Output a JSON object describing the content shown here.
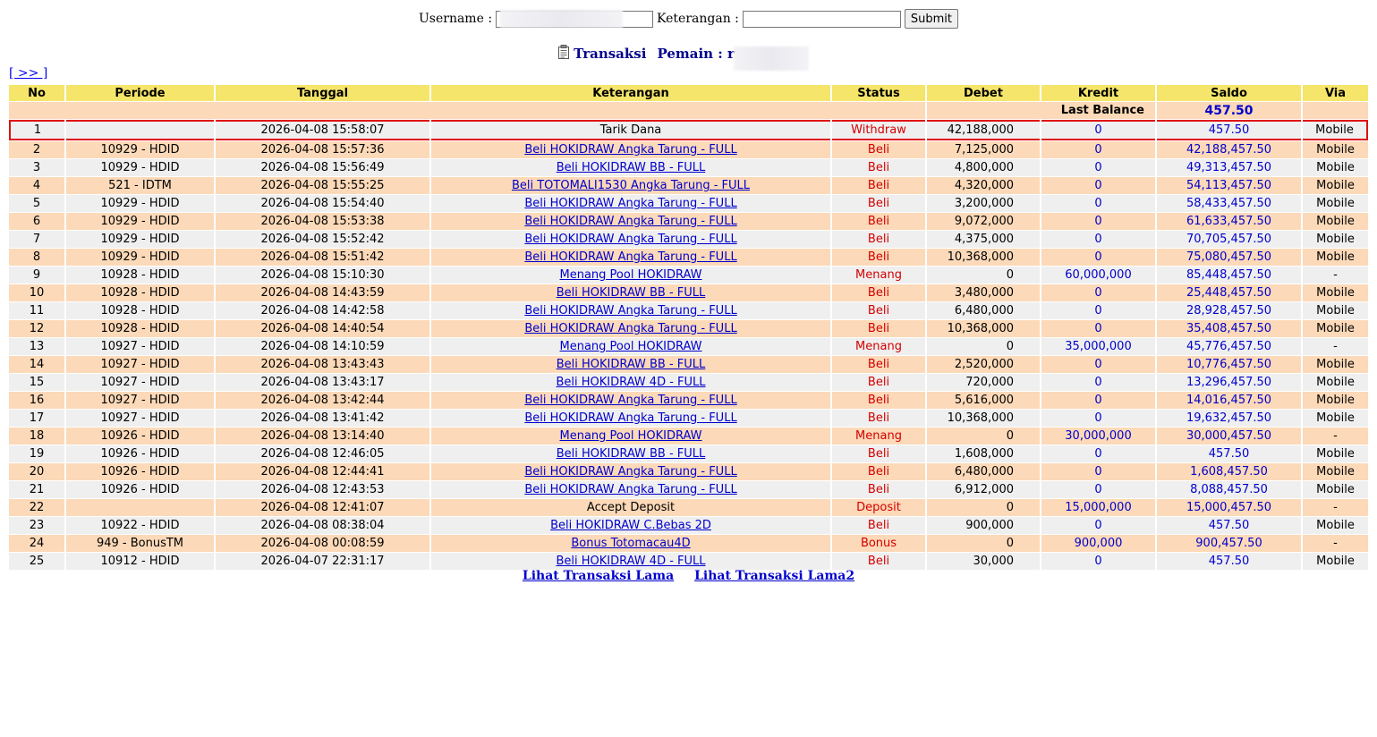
{
  "filter": {
    "username_label": "Username :",
    "username_value": "",
    "keterangan_label": "Keterangan :",
    "keterangan_value": "",
    "submit_label": "Submit"
  },
  "heading": {
    "title": "Transaksi",
    "player_label": "Pemain : ru"
  },
  "nav": {
    "next_label": "[ >> ]"
  },
  "table": {
    "columns": [
      "No",
      "Periode",
      "Tanggal",
      "Keterangan",
      "Status",
      "Debet",
      "Kredit",
      "Saldo",
      "Via"
    ],
    "last_balance_label": "Last Balance",
    "last_balance_value": "457.50",
    "rows": [
      {
        "no": "1",
        "periode": "",
        "tanggal": "2026-04-08 15:58:07",
        "keterangan": "Tarik Dana",
        "link": false,
        "status": "Withdraw",
        "debet": "42,188,000",
        "kredit": "0",
        "saldo": "457.50",
        "via": "Mobile"
      },
      {
        "no": "2",
        "periode": "10929 - HDID",
        "tanggal": "2026-04-08 15:57:36",
        "keterangan": "Beli HOKIDRAW Angka Tarung - FULL",
        "link": true,
        "status": "Beli",
        "debet": "7,125,000",
        "kredit": "0",
        "saldo": "42,188,457.50",
        "via": "Mobile"
      },
      {
        "no": "3",
        "periode": "10929 - HDID",
        "tanggal": "2026-04-08 15:56:49",
        "keterangan": "Beli HOKIDRAW BB - FULL",
        "link": true,
        "status": "Beli",
        "debet": "4,800,000",
        "kredit": "0",
        "saldo": "49,313,457.50",
        "via": "Mobile"
      },
      {
        "no": "4",
        "periode": "521 - IDTM",
        "tanggal": "2026-04-08 15:55:25",
        "keterangan": "Beli TOTOMALI1530 Angka Tarung - FULL",
        "link": true,
        "status": "Beli",
        "debet": "4,320,000",
        "kredit": "0",
        "saldo": "54,113,457.50",
        "via": "Mobile"
      },
      {
        "no": "5",
        "periode": "10929 - HDID",
        "tanggal": "2026-04-08 15:54:40",
        "keterangan": "Beli HOKIDRAW Angka Tarung - FULL",
        "link": true,
        "status": "Beli",
        "debet": "3,200,000",
        "kredit": "0",
        "saldo": "58,433,457.50",
        "via": "Mobile"
      },
      {
        "no": "6",
        "periode": "10929 - HDID",
        "tanggal": "2026-04-08 15:53:38",
        "keterangan": "Beli HOKIDRAW Angka Tarung - FULL",
        "link": true,
        "status": "Beli",
        "debet": "9,072,000",
        "kredit": "0",
        "saldo": "61,633,457.50",
        "via": "Mobile"
      },
      {
        "no": "7",
        "periode": "10929 - HDID",
        "tanggal": "2026-04-08 15:52:42",
        "keterangan": "Beli HOKIDRAW Angka Tarung - FULL",
        "link": true,
        "status": "Beli",
        "debet": "4,375,000",
        "kredit": "0",
        "saldo": "70,705,457.50",
        "via": "Mobile"
      },
      {
        "no": "8",
        "periode": "10929 - HDID",
        "tanggal": "2026-04-08 15:51:42",
        "keterangan": "Beli HOKIDRAW Angka Tarung - FULL",
        "link": true,
        "status": "Beli",
        "debet": "10,368,000",
        "kredit": "0",
        "saldo": "75,080,457.50",
        "via": "Mobile"
      },
      {
        "no": "9",
        "periode": "10928 - HDID",
        "tanggal": "2026-04-08 15:10:30",
        "keterangan": "Menang Pool HOKIDRAW",
        "link": true,
        "status": "Menang",
        "debet": "0",
        "kredit": "60,000,000",
        "saldo": "85,448,457.50",
        "via": "-"
      },
      {
        "no": "10",
        "periode": "10928 - HDID",
        "tanggal": "2026-04-08 14:43:59",
        "keterangan": "Beli HOKIDRAW BB - FULL",
        "link": true,
        "status": "Beli",
        "debet": "3,480,000",
        "kredit": "0",
        "saldo": "25,448,457.50",
        "via": "Mobile"
      },
      {
        "no": "11",
        "periode": "10928 - HDID",
        "tanggal": "2026-04-08 14:42:58",
        "keterangan": "Beli HOKIDRAW Angka Tarung - FULL",
        "link": true,
        "status": "Beli",
        "debet": "6,480,000",
        "kredit": "0",
        "saldo": "28,928,457.50",
        "via": "Mobile"
      },
      {
        "no": "12",
        "periode": "10928 - HDID",
        "tanggal": "2026-04-08 14:40:54",
        "keterangan": "Beli HOKIDRAW Angka Tarung - FULL",
        "link": true,
        "status": "Beli",
        "debet": "10,368,000",
        "kredit": "0",
        "saldo": "35,408,457.50",
        "via": "Mobile"
      },
      {
        "no": "13",
        "periode": "10927 - HDID",
        "tanggal": "2026-04-08 14:10:59",
        "keterangan": "Menang Pool HOKIDRAW",
        "link": true,
        "status": "Menang",
        "debet": "0",
        "kredit": "35,000,000",
        "saldo": "45,776,457.50",
        "via": "-"
      },
      {
        "no": "14",
        "periode": "10927 - HDID",
        "tanggal": "2026-04-08 13:43:43",
        "keterangan": "Beli HOKIDRAW BB - FULL",
        "link": true,
        "status": "Beli",
        "debet": "2,520,000",
        "kredit": "0",
        "saldo": "10,776,457.50",
        "via": "Mobile"
      },
      {
        "no": "15",
        "periode": "10927 - HDID",
        "tanggal": "2026-04-08 13:43:17",
        "keterangan": "Beli HOKIDRAW 4D - FULL",
        "link": true,
        "status": "Beli",
        "debet": "720,000",
        "kredit": "0",
        "saldo": "13,296,457.50",
        "via": "Mobile"
      },
      {
        "no": "16",
        "periode": "10927 - HDID",
        "tanggal": "2026-04-08 13:42:44",
        "keterangan": "Beli HOKIDRAW Angka Tarung - FULL",
        "link": true,
        "status": "Beli",
        "debet": "5,616,000",
        "kredit": "0",
        "saldo": "14,016,457.50",
        "via": "Mobile"
      },
      {
        "no": "17",
        "periode": "10927 - HDID",
        "tanggal": "2026-04-08 13:41:42",
        "keterangan": "Beli HOKIDRAW Angka Tarung - FULL",
        "link": true,
        "status": "Beli",
        "debet": "10,368,000",
        "kredit": "0",
        "saldo": "19,632,457.50",
        "via": "Mobile"
      },
      {
        "no": "18",
        "periode": "10926 - HDID",
        "tanggal": "2026-04-08 13:14:40",
        "keterangan": "Menang Pool HOKIDRAW",
        "link": true,
        "status": "Menang",
        "debet": "0",
        "kredit": "30,000,000",
        "saldo": "30,000,457.50",
        "via": "-"
      },
      {
        "no": "19",
        "periode": "10926 - HDID",
        "tanggal": "2026-04-08 12:46:05",
        "keterangan": "Beli HOKIDRAW BB - FULL",
        "link": true,
        "status": "Beli",
        "debet": "1,608,000",
        "kredit": "0",
        "saldo": "457.50",
        "via": "Mobile"
      },
      {
        "no": "20",
        "periode": "10926 - HDID",
        "tanggal": "2026-04-08 12:44:41",
        "keterangan": "Beli HOKIDRAW Angka Tarung - FULL",
        "link": true,
        "status": "Beli",
        "debet": "6,480,000",
        "kredit": "0",
        "saldo": "1,608,457.50",
        "via": "Mobile"
      },
      {
        "no": "21",
        "periode": "10926 - HDID",
        "tanggal": "2026-04-08 12:43:53",
        "keterangan": "Beli HOKIDRAW Angka Tarung - FULL",
        "link": true,
        "status": "Beli",
        "debet": "6,912,000",
        "kredit": "0",
        "saldo": "8,088,457.50",
        "via": "Mobile"
      },
      {
        "no": "22",
        "periode": "",
        "tanggal": "2026-04-08 12:41:07",
        "keterangan": "Accept Deposit",
        "link": false,
        "status": "Deposit",
        "debet": "0",
        "kredit": "15,000,000",
        "saldo": "15,000,457.50",
        "via": "-"
      },
      {
        "no": "23",
        "periode": "10922 - HDID",
        "tanggal": "2026-04-08 08:38:04",
        "keterangan": "Beli HOKIDRAW C.Bebas 2D",
        "link": true,
        "status": "Beli",
        "debet": "900,000",
        "kredit": "0",
        "saldo": "457.50",
        "via": "Mobile"
      },
      {
        "no": "24",
        "periode": "949 - BonusTM",
        "tanggal": "2026-04-08 00:08:59",
        "keterangan": "Bonus Totomacau4D",
        "link": true,
        "status": "Bonus",
        "debet": "0",
        "kredit": "900,000",
        "saldo": "900,457.50",
        "via": "-"
      },
      {
        "no": "25",
        "periode": "10912 - HDID",
        "tanggal": "2026-04-07 22:31:17",
        "keterangan": "Beli HOKIDRAW 4D - FULL",
        "link": true,
        "status": "Beli",
        "debet": "30,000",
        "kredit": "0",
        "saldo": "457.50",
        "via": "Mobile"
      }
    ]
  },
  "footer": {
    "old_link_label": "Lihat Transaksi Lama",
    "old2_link_label": "Lihat Transaksi Lama2"
  },
  "colors": {
    "header_bg": "#f5e56b",
    "row_gray": "#efefef",
    "row_peach": "#fcd9b8",
    "link_blue": "#0000cc",
    "status_red": "#d40000",
    "highlight_border": "#e01010"
  }
}
